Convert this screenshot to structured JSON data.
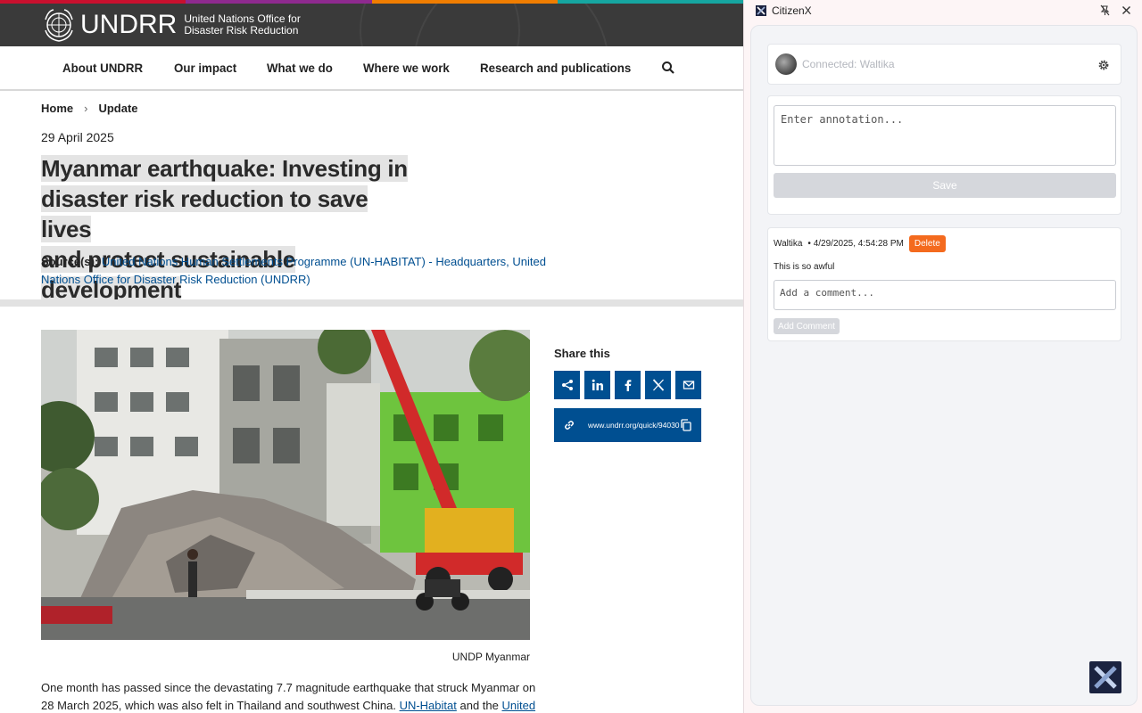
{
  "site": {
    "logo": {
      "word": "UNDRR",
      "sub_line1": "United Nations Office for",
      "sub_line2": "Disaster Risk Reduction"
    },
    "nav": [
      "About UNDRR",
      "Our impact",
      "What we do",
      "Where we work",
      "Research and publications"
    ],
    "breadcrumb": {
      "home": "Home",
      "current": "Update"
    },
    "date": "29 April 2025",
    "title_lines": [
      "Myanmar earthquake: Investing in",
      "disaster risk reduction to save lives",
      "and protect sustainable development"
    ],
    "sources": {
      "label": "Source(s):",
      "links": [
        "United Nations Human Settlements Programme (UN-HABITAT) - Headquarters",
        "United Nations Office for Disaster Risk Reduction (UNDRR)"
      ]
    },
    "caption": "UNDP Myanmar",
    "body": {
      "part1": "One month has passed since the devastating 7.7 magnitude earthquake that struck Myanmar on 28 March 2025, which was also felt in Thailand and southwest China.",
      "link1": "UN-Habitat",
      "part2": "and the",
      "link2": "United Nations"
    },
    "share": {
      "title": "Share this",
      "quicklink": "www.undrr.org/quick/94030"
    },
    "colors": {
      "header_bg": "#3a3a3a",
      "link": "#004f91",
      "share_bg": "#004f91",
      "stripe": [
        "#e5243b",
        "#a21942",
        "#f36d25",
        "#00aed9",
        "#19a39a",
        "#56c02b"
      ]
    },
    "icons": [
      "un-emblem-icon",
      "search-icon",
      "share-icon",
      "linkedin-icon",
      "facebook-icon",
      "x-icon",
      "email-icon",
      "link-icon",
      "copy-icon"
    ]
  },
  "panel": {
    "name": "CitizenX",
    "connected": "Connected: Waltika",
    "annotation_placeholder": "Enter annotation...",
    "save_label": "Save",
    "comment": {
      "author": "Waltika",
      "timestamp": "• 4/29/2025, 4:54:28 PM",
      "delete_label": "Delete",
      "text": "This is so awful",
      "reply_placeholder": "Add a comment...",
      "add_label": "Add Comment"
    },
    "colors": {
      "accent": "#f46a1e",
      "brand": "#1b2340",
      "disabled": "#d5d7dc"
    }
  }
}
